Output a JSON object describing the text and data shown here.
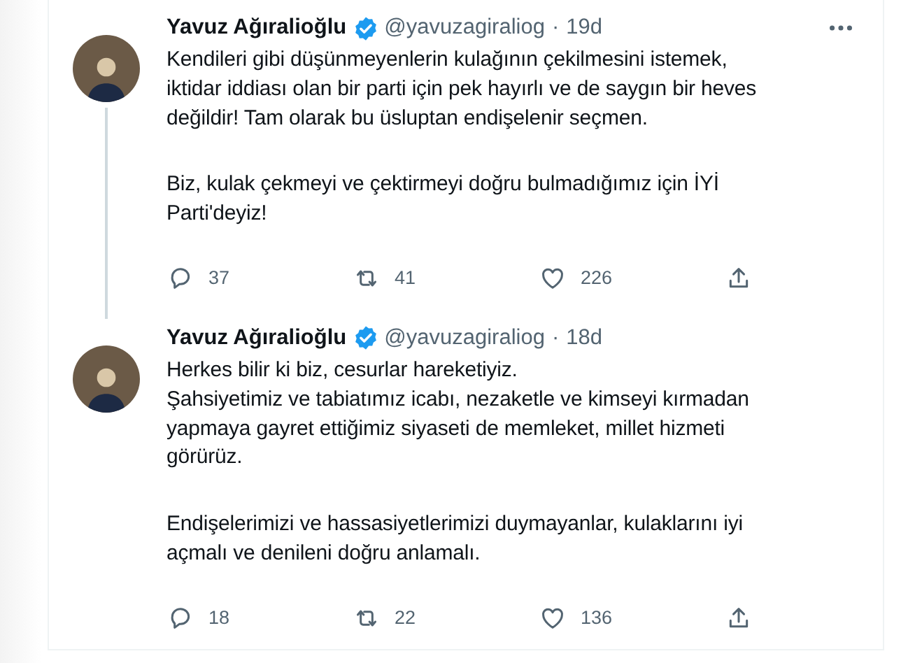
{
  "tweets": [
    {
      "author": {
        "name": "Yavuz Ağıralioğlu",
        "verified": true,
        "handle": "@yavuzagiraliog",
        "separator": "·",
        "time": "19d"
      },
      "more": true,
      "thread_line": true,
      "paragraphs": [
        "Kendileri gibi düşünmeyenlerin kulağının çekilmesini istemek,\niktidar iddiası olan bir parti için pek hayırlı ve de saygın bir heves\ndeğildir! Tam olarak bu üsluptan endişelenir seçmen.",
        "Biz, kulak çekmeyi ve çektirmeyi doğru bulmadığımız için İYİ\nParti'deyiz!"
      ],
      "actions": [
        {
          "kind": "reply",
          "count": "37"
        },
        {
          "kind": "retweet",
          "count": "41"
        },
        {
          "kind": "like",
          "count": "226"
        },
        {
          "kind": "share"
        }
      ]
    },
    {
      "author": {
        "name": "Yavuz Ağıralioğlu",
        "verified": true,
        "handle": "@yavuzagiraliog",
        "separator": "·",
        "time": "18d"
      },
      "more": false,
      "thread_line": false,
      "paragraphs": [
        "Herkes bilir ki biz, cesurlar hareketiyiz.\nŞahsiyetimiz ve tabiatımız icabı, nezaketle ve kimseyi kırmadan\nyapmaya gayret ettiğimiz siyaseti de memleket, millet hizmeti\ngörürüz.",
        "Endişelerimizi ve hassasiyetlerimizi duymayanlar, kulaklarını iyi\naçmalı ve denileni doğru anlamalı."
      ],
      "actions": [
        {
          "kind": "reply",
          "count": "18"
        },
        {
          "kind": "retweet",
          "count": "22"
        },
        {
          "kind": "like",
          "count": "136"
        },
        {
          "kind": "share"
        }
      ]
    }
  ]
}
